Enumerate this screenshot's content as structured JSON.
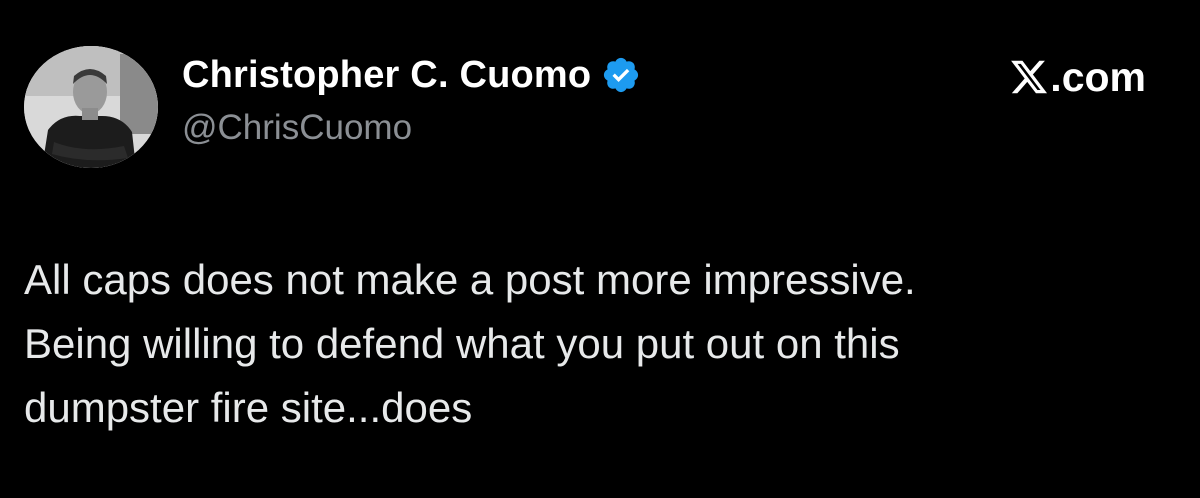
{
  "author": {
    "display_name": "Christopher C. Cuomo",
    "handle": "@ChrisCuomo",
    "verified": true,
    "verified_icon": "verified-badge-icon",
    "avatar": "profile-photo"
  },
  "brand": {
    "logo_icon": "x-logo-icon",
    "suffix": ".com"
  },
  "tweet": {
    "lines": [
      "All caps does not make a post more impressive.",
      "Being willing to defend what you put out on this",
      "dumpster fire site...does"
    ]
  },
  "colors": {
    "background": "#000000",
    "name": "#ffffff",
    "handle": "#8b8f94",
    "body_text": "#e7e9ea",
    "verified_badge": "#1d9bf0"
  }
}
